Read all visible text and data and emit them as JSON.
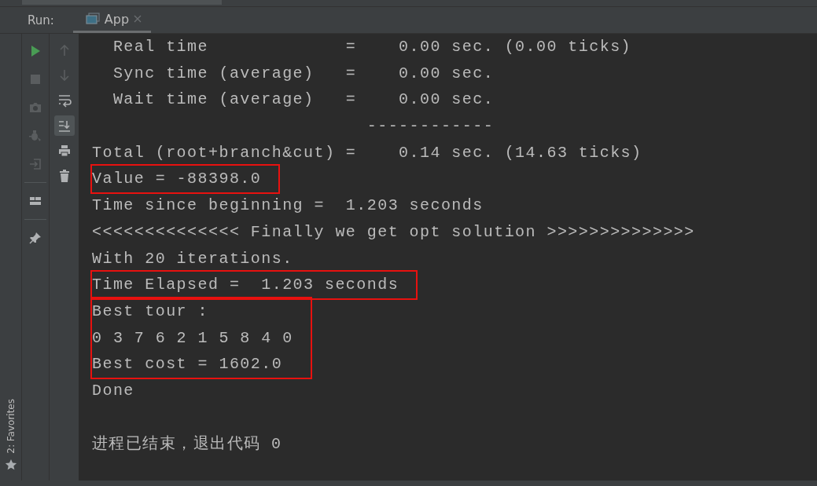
{
  "run_bar": {
    "label": "Run:",
    "tab": {
      "title": "App",
      "selected": true
    }
  },
  "toolbar_left": [
    {
      "kind": "play",
      "disabled": false
    },
    {
      "kind": "stop",
      "disabled": true
    },
    {
      "kind": "camera",
      "disabled": true
    },
    {
      "kind": "bug",
      "disabled": true
    },
    {
      "kind": "exit",
      "disabled": true
    },
    {
      "kind": "layout",
      "disabled": false
    },
    {
      "kind": "pin",
      "disabled": false
    }
  ],
  "toolbar_right": [
    {
      "kind": "up",
      "disabled": true,
      "on": false
    },
    {
      "kind": "down",
      "disabled": true,
      "on": false
    },
    {
      "kind": "wrap",
      "disabled": false,
      "on": false
    },
    {
      "kind": "scroll-end",
      "disabled": false,
      "on": true
    },
    {
      "kind": "print",
      "disabled": false,
      "on": false
    },
    {
      "kind": "trash",
      "disabled": false,
      "on": false
    }
  ],
  "side_stripe": {
    "label": "2: Favorites"
  },
  "console": {
    "blocks": [
      {
        "boxed": false,
        "lines": [
          "  Real time             =    0.00 sec. (0.00 ticks)",
          "  Sync time (average)   =    0.00 sec.",
          "  Wait time (average)   =    0.00 sec.",
          "                          ------------",
          "Total (root+branch&cut) =    0.14 sec. (14.63 ticks)"
        ]
      },
      {
        "boxed": true,
        "lines": [
          "Value = -88398.0"
        ]
      },
      {
        "boxed": false,
        "lines": [
          "Time since beginning =  1.203 seconds",
          "<<<<<<<<<<<<<< Finally we get opt solution >>>>>>>>>>>>>>",
          "With 20 iterations."
        ]
      },
      {
        "boxed": true,
        "lines": [
          "Time Elapsed =  1.203 seconds"
        ]
      },
      {
        "boxed": true,
        "lines": [
          "Best tour :",
          "0 3 7 6 2 1 5 8 4 0",
          "Best cost = 1602.0"
        ]
      },
      {
        "boxed": false,
        "lines": [
          "Done"
        ]
      },
      {
        "boxed": false,
        "lines": [
          "进程已结束，退出代码 0"
        ]
      }
    ]
  }
}
